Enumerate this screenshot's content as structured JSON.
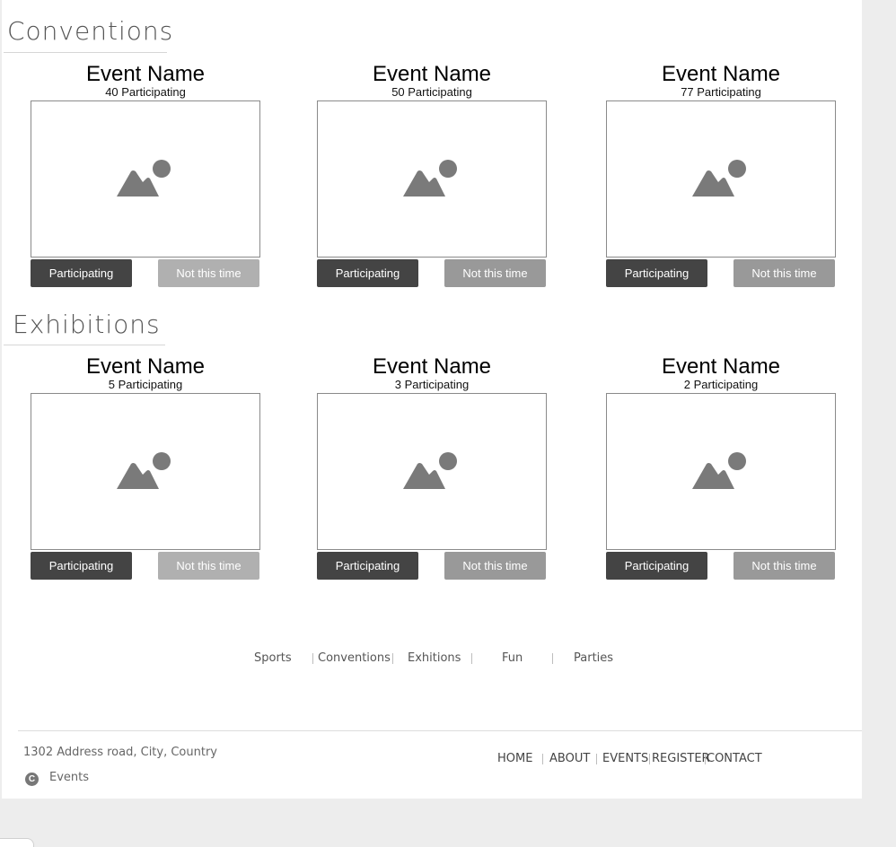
{
  "sections": [
    {
      "title": "Conventions",
      "events": [
        {
          "name": "Event Name",
          "count": "40 Participating",
          "yes": "Participating",
          "no": "Not this time"
        },
        {
          "name": "Event Name",
          "count": "50 Participating",
          "yes": "Participating",
          "no": "Not this time"
        },
        {
          "name": "Event Name",
          "count": "77 Participating",
          "yes": "Participating",
          "no": "Not this time"
        }
      ]
    },
    {
      "title": "Exhibitions",
      "events": [
        {
          "name": "Event Name",
          "count": "5 Participating",
          "yes": "Participating",
          "no": "Not this time"
        },
        {
          "name": "Event Name",
          "count": "3 Participating",
          "yes": "Participating",
          "no": "Not this time"
        },
        {
          "name": "Event Name",
          "count": "2 Participating",
          "yes": "Participating",
          "no": "Not this time"
        }
      ]
    }
  ],
  "category_nav": [
    "Sports",
    "Conventions",
    "Exhitions",
    "Fun",
    "Parties"
  ],
  "footer": {
    "address": "1302 Address road, City, Country",
    "copyright_label": "Events",
    "nav": [
      "HOME",
      "ABOUT",
      "EVENTS",
      "REGISTER",
      "CONTACT"
    ]
  },
  "icons": {
    "image_placeholder": "image-placeholder-icon",
    "copyright": "copyright-icon"
  },
  "colors": {
    "primary_button": "#444444",
    "secondary_button": "#999999",
    "secondary_button_light": "#b0b0b0",
    "image_icon": "#7a7a7a"
  }
}
